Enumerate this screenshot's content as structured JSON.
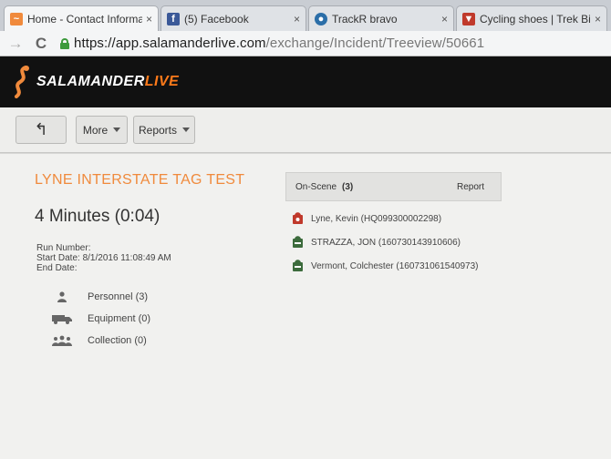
{
  "browser": {
    "tabs": [
      {
        "title": "Home - Contact Informat",
        "icon": "salamander-favicon-icon",
        "color": "#f08a3c",
        "active": true
      },
      {
        "title": "(5) Facebook",
        "icon": "facebook-icon",
        "color": "#3b5998",
        "active": false
      },
      {
        "title": "TrackR bravo",
        "icon": "trackr-icon",
        "color": "#2b6ea8",
        "active": false
      },
      {
        "title": "Cycling shoes | Trek Bikes",
        "icon": "trek-icon",
        "color": "#c0392b",
        "active": false
      }
    ],
    "close_glyph": "×",
    "url_host": "https://app.salamanderlive.com",
    "url_path": "/exchange/Incident/Treeview/50661"
  },
  "app": {
    "brand_primary": "SALAMANDER",
    "brand_accent": "LIVE",
    "accent_color": "#f08a3c"
  },
  "toolbar": {
    "back_glyph": "↰",
    "more_label": "More",
    "reports_label": "Reports"
  },
  "incident": {
    "title": "LYNE INTERSTATE TAG TEST",
    "elapsed": "4 Minutes (0:04)",
    "run_number_label": "Run Number:",
    "start_date_label": "Start Date:",
    "start_date_value": "8/1/2016 11:08:49 AM",
    "end_date_label": "End Date:"
  },
  "resources": [
    {
      "label": "Personnel (3)",
      "icon": "personnel-icon"
    },
    {
      "label": "Equipment (0)",
      "icon": "equipment-icon"
    },
    {
      "label": "Collection (0)",
      "icon": "collection-icon"
    }
  ],
  "on_scene": {
    "label": "On-Scene",
    "count": "(3)",
    "report_label": "Report",
    "people": [
      {
        "name": "Lyne, Kevin (HQ099300002298)",
        "icon": "commander-icon",
        "color": "#c0392b"
      },
      {
        "name": "STRAZZA, JON (160730143910606)",
        "icon": "responder-icon",
        "color": "#3c6b3c"
      },
      {
        "name": "Vermont, Colchester (160731061540973)",
        "icon": "responder-icon",
        "color": "#3c6b3c"
      }
    ]
  }
}
